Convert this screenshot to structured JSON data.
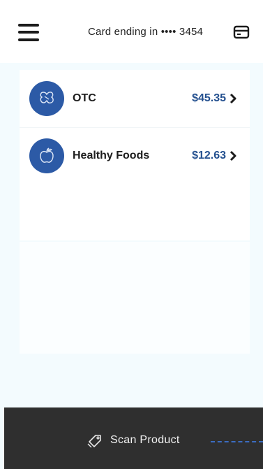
{
  "header": {
    "menu_icon": "hamburger-menu-icon",
    "card_label": "Card ending in •••• 3454",
    "card_icon": "credit-card-icon"
  },
  "benefits": [
    {
      "label": "OTC",
      "amount": "$45.35",
      "icon": "pill-icon"
    },
    {
      "label": "Healthy Foods",
      "amount": "$12.63",
      "icon": "apple-icon"
    }
  ],
  "bottom": {
    "scan_label": "Scan Product",
    "scan_icon": "tag-icon"
  },
  "colors": {
    "accent": "#2c5aa6",
    "amount": "#24508f",
    "bar": "#2f2f2f",
    "background": "#f3fbfe"
  }
}
